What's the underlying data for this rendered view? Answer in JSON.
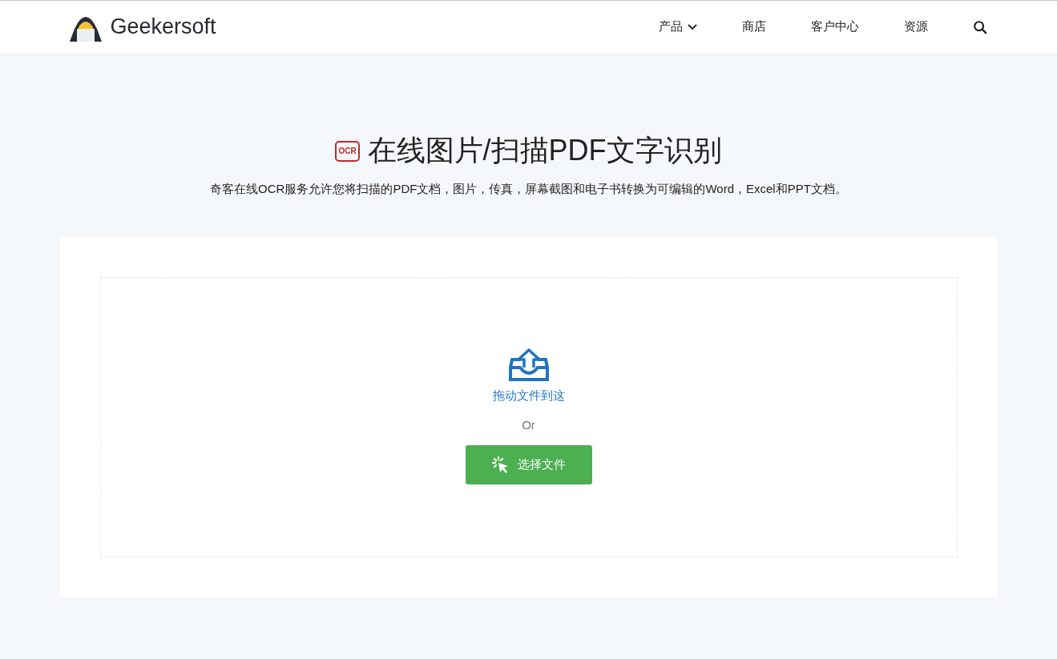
{
  "header": {
    "brand": "Geekersoft",
    "nav": [
      {
        "label": "产品",
        "dropdown": true
      },
      {
        "label": "商店",
        "dropdown": false
      },
      {
        "label": "客户中心",
        "dropdown": false
      },
      {
        "label": "资源",
        "dropdown": false
      }
    ]
  },
  "hero": {
    "badge": "OCR",
    "title": "在线图片/扫描PDF文字识别",
    "subtitle": "奇客在线OCR服务允许您将扫描的PDF文档，图片，传真，屏幕截图和电子书转换为可编辑的Word，Excel和PPT文档。"
  },
  "upload": {
    "drop_text": "拖动文件到这",
    "or_text": "Or",
    "button": "选择文件"
  }
}
